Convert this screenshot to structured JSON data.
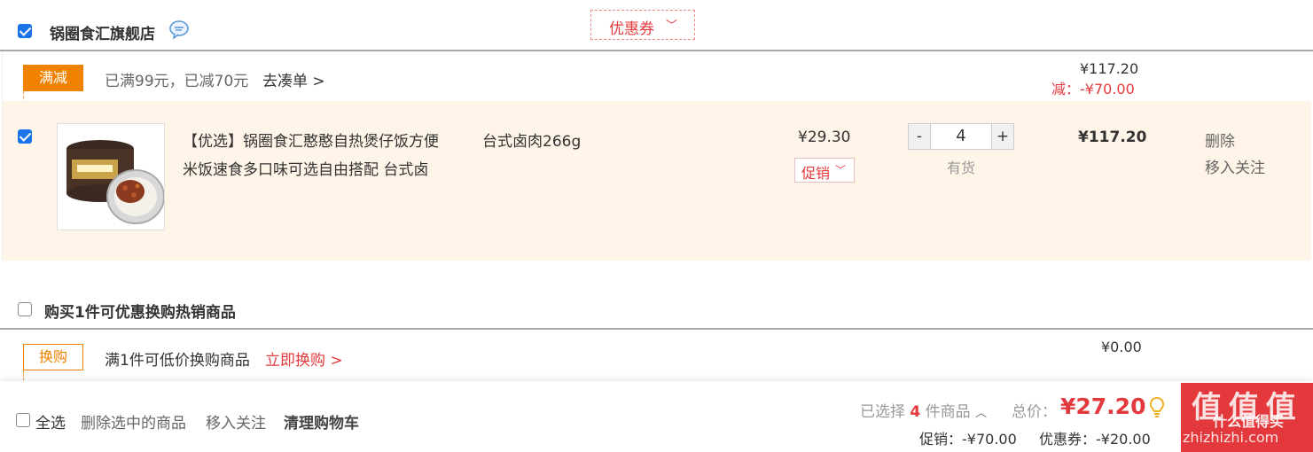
{
  "shop": {
    "name": "锅圈食汇旗舰店",
    "icon": "chat-bubble-icon",
    "coupon_label": "优惠券",
    "coupon_arrow": "chevron-down-icon"
  },
  "promo1": {
    "tag": "满减",
    "text": "已满99元，已减70元",
    "link": "去凑单 >",
    "original": "¥117.20",
    "reduced": "减：-¥70.00"
  },
  "item": {
    "title_line1": "【优选】锅圈食汇憨憨自热煲仔饭方便",
    "title_line2": "米饭速食多口味可选自由搭配 台式卤",
    "spec": "台式卤肉266g",
    "price": "¥29.30",
    "promo_btn": "促销",
    "qty_minus": "-",
    "qty": "4",
    "qty_plus": "+",
    "stock": "有货",
    "subtotal": "¥117.20",
    "delete": "删除",
    "follow": "移入关注"
  },
  "section2": {
    "title": "购买1件可优惠换购热销商品",
    "tag": "换购",
    "text": "满1件可低价换购商品",
    "link": "立即换购 >",
    "amount": "¥0.00"
  },
  "footer": {
    "select_all": "全选",
    "delete_selected": "删除选中的商品",
    "move_follow": "移入关注",
    "clear_cart": "清理购物车",
    "selected_prefix": "已选择",
    "selected_count": "4",
    "selected_suffix": "件商品",
    "total_label": "总价：",
    "total": "¥27.20",
    "promo_discount": "促销：-¥70.00",
    "coupon_discount": "优惠券：-¥20.00",
    "watermark": "值 值 值",
    "watermark_sub": "什么值得买",
    "watermark_domain": "zhizhizhi.com"
  },
  "colors": {
    "accent": "#e4393c",
    "orange": "#f08200",
    "row_bg": "#fff4e8"
  }
}
